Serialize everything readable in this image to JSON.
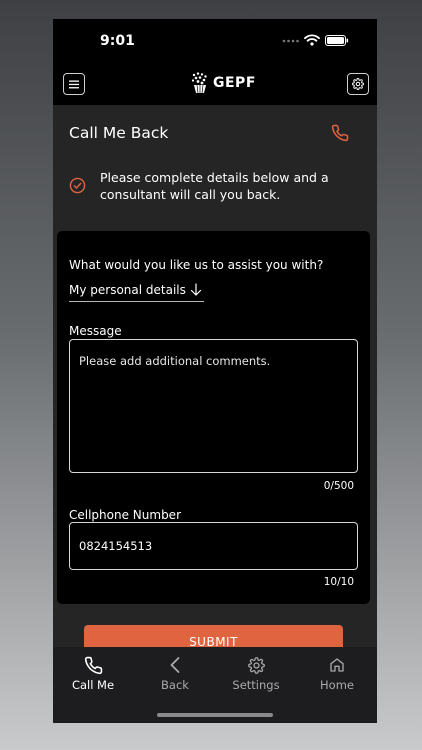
{
  "status_bar": {
    "time": "9:01"
  },
  "header": {
    "logo_text": "GEPF",
    "menu_icon": "hamburger-icon",
    "settings_icon": "gear-icon"
  },
  "page": {
    "title": "Call Me Back",
    "title_icon": "phone-icon",
    "info_text": "Please complete details below and a consultant will call you back."
  },
  "form": {
    "question_label": "What would you like us to assist you with?",
    "topic_value": "My personal details",
    "message_label": "Message",
    "message_placeholder": "Please add additional comments.",
    "message_counter": "0/500",
    "cell_label": "Cellphone Number",
    "cell_value": "0824154513",
    "cell_counter": "10/10",
    "submit_label": "SUBMIT"
  },
  "nav": {
    "items": [
      {
        "label": "Call Me",
        "icon": "phone-icon",
        "active": true
      },
      {
        "label": "Back",
        "icon": "chevron-left-icon",
        "active": false
      },
      {
        "label": "Settings",
        "icon": "gear-icon",
        "active": false
      },
      {
        "label": "Home",
        "icon": "home-icon",
        "active": false
      }
    ]
  },
  "colors": {
    "accent": "#e0643f",
    "background": "#252526",
    "card": "#000000"
  }
}
